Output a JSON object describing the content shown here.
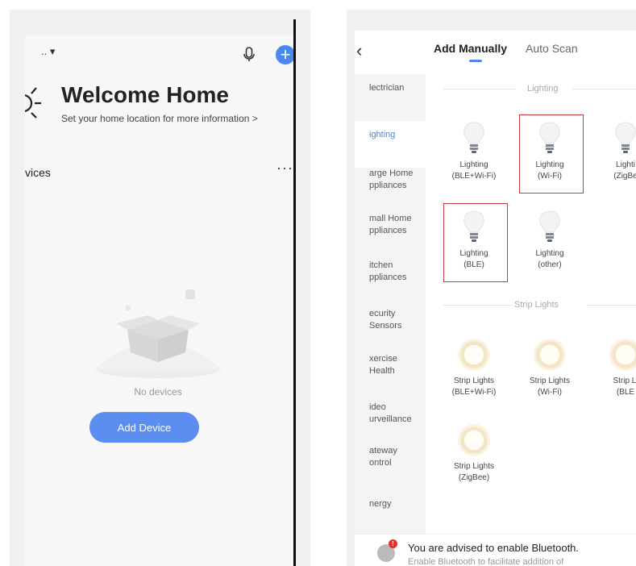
{
  "left_screen": {
    "home_selector": ".. ▾",
    "add_icon": "plus-icon",
    "mic_icon": "microphone-icon",
    "title": "Welcome Home",
    "subtitle": "Set your home location for more information >",
    "devices_label": "vices",
    "more_label": "···",
    "empty_text": "No devices",
    "add_device_button": "Add Device"
  },
  "right_screen": {
    "back_icon": "‹",
    "tabs": [
      {
        "label": "Add Manually",
        "active": true
      },
      {
        "label": "Auto Scan",
        "active": false
      }
    ],
    "categories": [
      "lectrician",
      "ighting",
      "arge Home\nppliances",
      "mall Home\nppliances",
      "itchen\nppliances",
      "ecurity\n Sensors",
      "xercise\n Health",
      "ideo\nurveillance",
      "ateway\nontrol",
      "nergy"
    ],
    "active_category_index": 1,
    "sections": {
      "lighting": {
        "title": "Lighting",
        "items": [
          {
            "label": "Lighting\n(BLE+Wi-Fi)",
            "highlighted": false
          },
          {
            "label": "Lighting\n(Wi-Fi)",
            "highlighted": true
          },
          {
            "label": "Lighti\n(ZigBe",
            "highlighted": false
          },
          {
            "label": "Lighting\n(BLE)",
            "highlighted": true
          },
          {
            "label": "Lighting\n(other)",
            "highlighted": false
          }
        ]
      },
      "strip_lights": {
        "title": "Strip Lights",
        "items": [
          {
            "label": "Strip Lights\n(BLE+Wi-Fi)"
          },
          {
            "label": "Strip Lights\n(Wi-Fi)"
          },
          {
            "label": "Strip Li\n(BLE"
          },
          {
            "label": "Strip Lights\n(ZigBee)"
          }
        ]
      }
    },
    "bluetooth_notice": {
      "title": "You are advised to enable Bluetooth.",
      "subtitle": "Enable Bluetooth to facilitate addition of",
      "badge": "!"
    }
  },
  "colors": {
    "accent_blue": "#4a87f0",
    "highlight_red": "#cc3b3b",
    "badge_red": "#e0322f"
  }
}
